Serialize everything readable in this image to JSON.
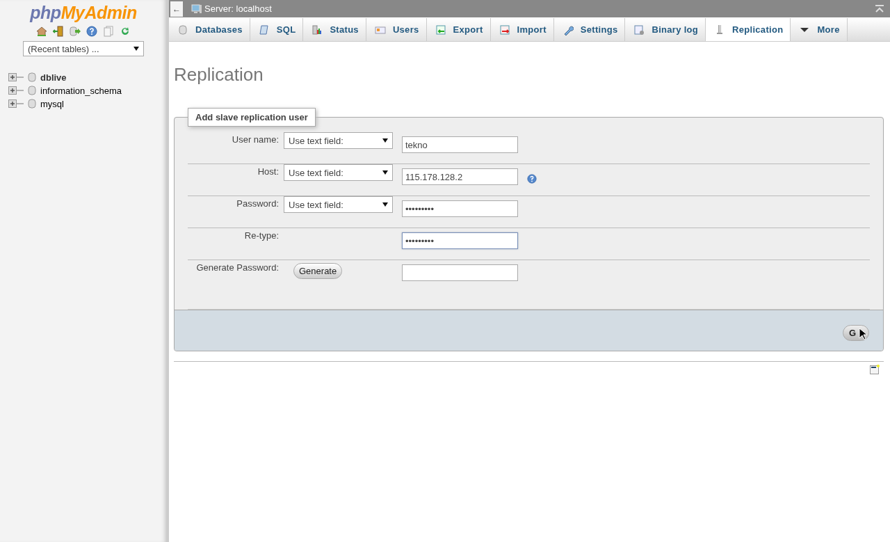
{
  "sidebar": {
    "logo": {
      "part_1": "php",
      "part_2": "MyAdmin"
    },
    "recent_tables": "(Recent tables) ...",
    "databases": [
      {
        "name": "dblive",
        "selected": true
      },
      {
        "name": "information_schema",
        "selected": false
      },
      {
        "name": "mysql",
        "selected": false
      }
    ]
  },
  "top_bar": {
    "back": "←",
    "title": "Server: localhost"
  },
  "tabs": [
    {
      "label": "Databases",
      "selected": false
    },
    {
      "label": "SQL",
      "selected": false
    },
    {
      "label": "Status",
      "selected": false
    },
    {
      "label": "Users",
      "selected": false
    },
    {
      "label": "Export",
      "selected": false
    },
    {
      "label": "Import",
      "selected": false
    },
    {
      "label": "Settings",
      "selected": false
    },
    {
      "label": "Binary log",
      "selected": false
    },
    {
      "label": "Replication",
      "selected": true
    },
    {
      "label": "More",
      "selected": false
    }
  ],
  "page_title": "Replication",
  "form": {
    "legend": "Add slave replication user",
    "rows": [
      {
        "kind": "select",
        "label": "User name:",
        "select": "Use text field:",
        "value": "tekno",
        "help": false,
        "focused": false
      },
      {
        "kind": "select",
        "label": "Host:",
        "select": "Use text field:",
        "value": "115.178.128.2",
        "help": true,
        "focused": false
      },
      {
        "kind": "select",
        "label": "Password:",
        "select": "Use text field:",
        "value": "•••••••••",
        "help": false,
        "focused": false
      },
      {
        "kind": "plain",
        "label": "Re-type:",
        "value": "•••••••••",
        "help": false,
        "focused": true
      },
      {
        "kind": "button",
        "label": "Generate Password:",
        "button": "Generate",
        "help": false,
        "focused": false
      }
    ],
    "submit": "G"
  }
}
